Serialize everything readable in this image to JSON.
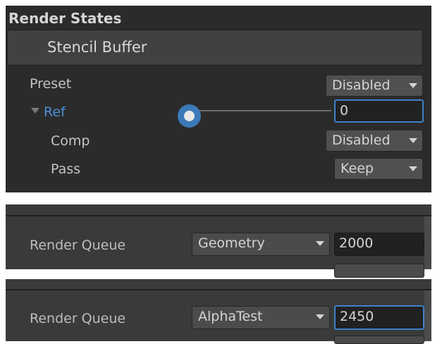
{
  "stencil_panel": {
    "title": "Render States",
    "section_button": "Stencil Buffer",
    "rows": {
      "preset": {
        "label": "Preset",
        "value": "Disabled"
      },
      "ref": {
        "label": "Ref",
        "value": "0",
        "slider_level": 0
      },
      "comp": {
        "label": "Comp",
        "value": "Disabled"
      },
      "pass": {
        "label": "Pass",
        "value": "Keep"
      }
    }
  },
  "queue_panel_1": {
    "label": "Render Queue",
    "dropdown": "Geometry",
    "value": "2000"
  },
  "queue_panel_2": {
    "label": "Render Queue",
    "dropdown": "AlphaTest",
    "value": "2450"
  },
  "colors": {
    "accent": "#3d82c9",
    "ref_label": "#4d8fd6",
    "panel_bg": "#2b2b2b"
  }
}
